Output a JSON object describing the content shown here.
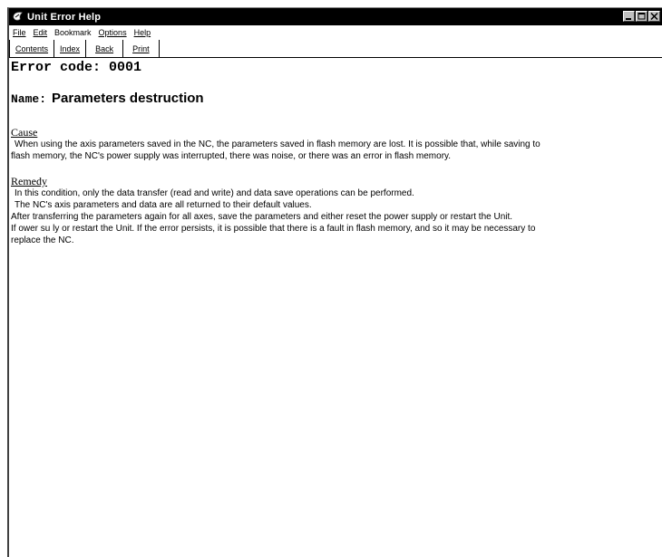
{
  "window": {
    "title": "Unit Error Help",
    "icon": "app-icon"
  },
  "menu": {
    "items": [
      "File",
      "Edit",
      "Bookmark",
      "Options",
      "Help"
    ]
  },
  "toolbar": {
    "buttons": [
      "Contents",
      "Index",
      "Back",
      "Print"
    ]
  },
  "doc": {
    "error_code": "Error code: 0001",
    "name_label": "Name:",
    "name_value": "Parameters destruction",
    "cause_title": "Cause",
    "cause_lines": [
      "When using the axis parameters saved in the NC, the parameters saved in flash memory are lost. It is possible that, while saving to",
      "flash memory, the NC's power supply was interrupted, there was noise, or there was an error in flash memory."
    ],
    "remedy_title": "Remedy",
    "remedy_lines": [
      "In this condition, only the data transfer (read and write) and data save operations can be performed.",
      "The NC's axis parameters and data are all returned to their default values.",
      "After transferring the parameters again for all axes, save the parameters and either reset the power supply or restart the Unit.",
      "If ower su ly or restart the Unit. If the error persists, it is possible that there is a fault in flash memory, and so it may be necessary to",
      "replace the NC."
    ]
  }
}
